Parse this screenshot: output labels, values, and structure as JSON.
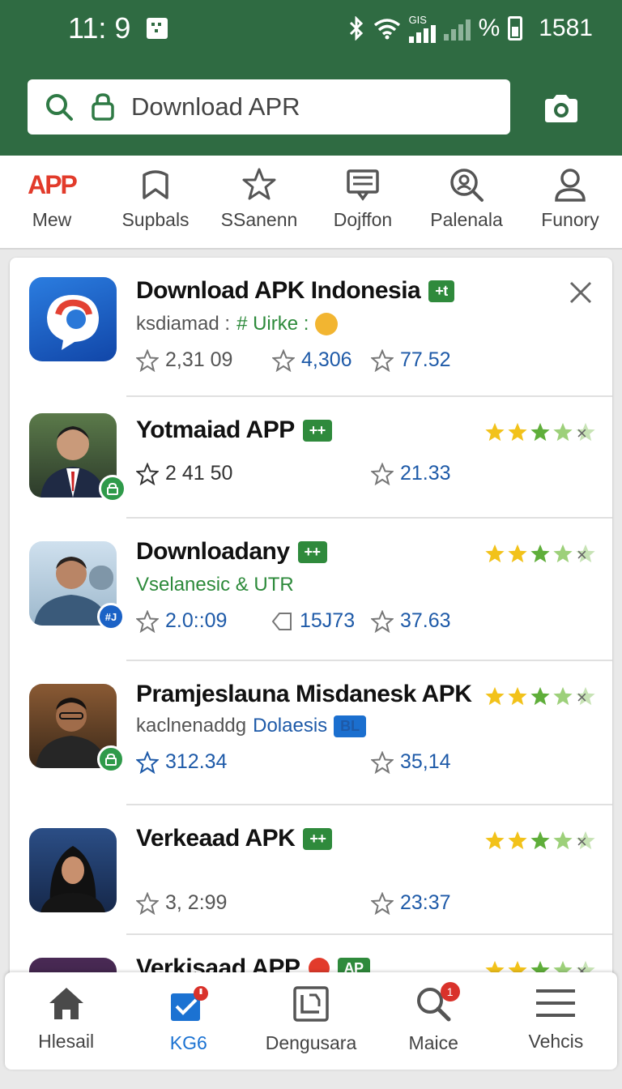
{
  "status": {
    "time": "11: 9",
    "network": "GIS",
    "percent": "%",
    "battery_text": "1581"
  },
  "search": {
    "value": "Download APR"
  },
  "categories": [
    {
      "logo_text": "APP",
      "label": "Mew"
    },
    {
      "label": "Supbals"
    },
    {
      "label": "SSanenn"
    },
    {
      "label": "Dojffon"
    },
    {
      "label": "Palenala"
    },
    {
      "label": "Funory"
    }
  ],
  "apps": [
    {
      "title": "Download APK Indonesia",
      "tag": "+t",
      "sub_gray": "ksdiamad :",
      "sub_green": "# Uirke :",
      "stats": [
        "2,31 09",
        "4,306",
        "77.52"
      ],
      "colors": {
        "brand": "#2f8a3c"
      }
    },
    {
      "title": "Yotmaiad APP",
      "tag": "++",
      "stats": [
        "2 41 50",
        "21.33"
      ],
      "rating": 4
    },
    {
      "title": "Downloadany",
      "tag": "++",
      "sub_green": "Vselanesic & UTR",
      "stats": [
        "2.0::09",
        "15J73",
        "37.63"
      ],
      "badge": "#J",
      "rating": 4
    },
    {
      "title": "Pramjeslauna Misdanesk APK",
      "sub_gray": "kaclnenaddg",
      "sub_blue": "Dolaesis",
      "tag": "BL",
      "stats": [
        "312.34",
        "35,14"
      ],
      "rating": 4
    },
    {
      "title": "Verkeaad APK",
      "tag": "++",
      "stats": [
        "3, 2:99",
        "23:37"
      ],
      "rating": 4
    },
    {
      "title": "Verkisaad APP",
      "tag": "AP"
    }
  ],
  "nav": [
    {
      "label": "Hlesail"
    },
    {
      "label": "KG6"
    },
    {
      "label": "Dengusara"
    },
    {
      "label": "Maice",
      "badge": "1"
    },
    {
      "label": "Vehcis"
    }
  ]
}
